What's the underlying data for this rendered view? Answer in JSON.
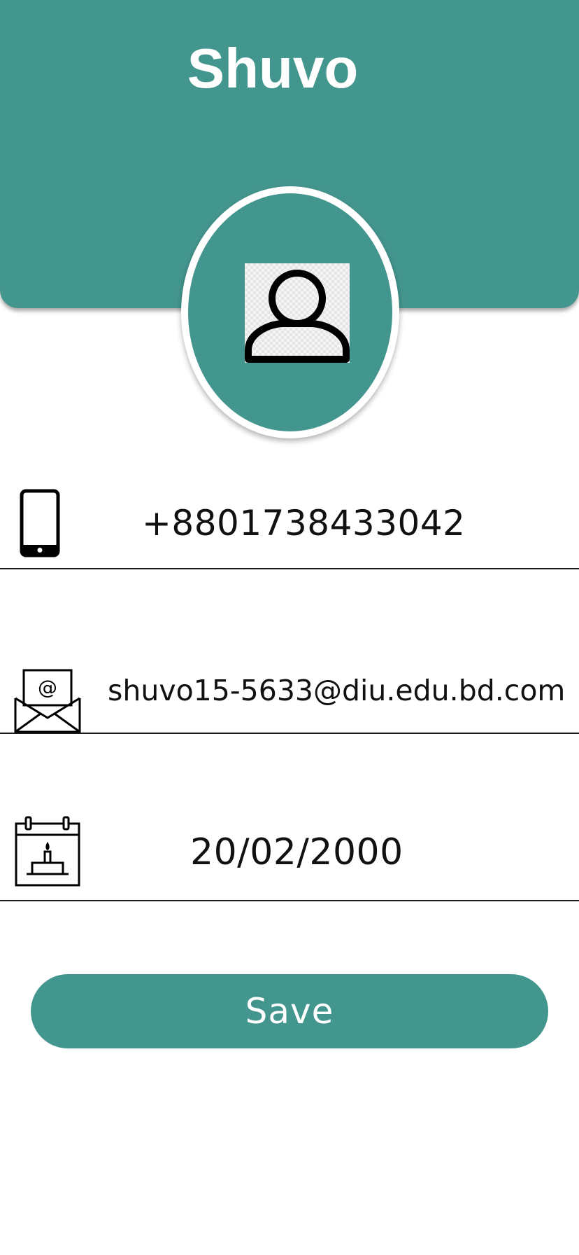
{
  "profile": {
    "name": "Shuvo"
  },
  "fields": {
    "phone": "+8801738433042",
    "email": "shuvo15-5633@diu.edu.bd.com",
    "birth_date": "20/02/2000"
  },
  "actions": {
    "save_label": "Save"
  },
  "icons": {
    "avatar": "user-avatar-icon",
    "phone": "mobile-phone-icon",
    "email": "envelope-at-icon",
    "birth_date": "birthday-calendar-icon"
  },
  "colors": {
    "primary": "#43968e",
    "background": "#ffffff",
    "text": "#111111"
  }
}
